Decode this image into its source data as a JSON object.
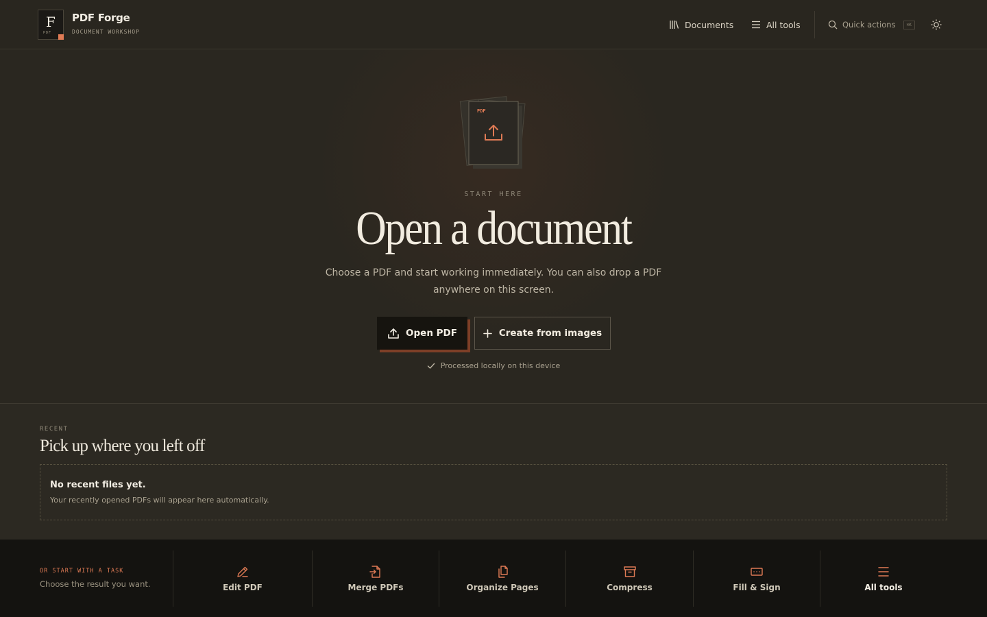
{
  "header": {
    "brand_letter": "F",
    "brand_badge": "PDF",
    "brand_name": "PDF Forge",
    "brand_tagline": "DOCUMENT WORKSHOP",
    "nav": {
      "documents": "Documents",
      "all_tools": "All tools",
      "quick_actions": "Quick actions",
      "quick_actions_shortcut": "⌘K"
    }
  },
  "hero": {
    "doc_badge": "PDF",
    "eyebrow": "START HERE",
    "title": "Open a document",
    "description": "Choose a PDF and start working immediately. You can also drop a PDF anywhere on this screen.",
    "open_button": "Open PDF",
    "create_button": "Create from images",
    "local_note": "Processed locally on this device"
  },
  "recent": {
    "eyebrow": "RECENT",
    "title": "Pick up where you left off",
    "empty_title": "No recent files yet.",
    "empty_description": "Your recently opened PDFs will appear here automatically."
  },
  "tasks": {
    "eyebrow": "OR START WITH A TASK",
    "subtitle": "Choose the result you want.",
    "items": [
      {
        "label": "Edit PDF",
        "icon": "pencil-icon"
      },
      {
        "label": "Merge PDFs",
        "icon": "file-merge-icon"
      },
      {
        "label": "Organize Pages",
        "icon": "pages-stack-icon"
      },
      {
        "label": "Compress",
        "icon": "archive-box-icon"
      },
      {
        "label": "Fill & Sign",
        "icon": "form-field-icon"
      },
      {
        "label": "All tools",
        "icon": "menu-lines-icon"
      }
    ]
  },
  "colors": {
    "accent": "#e07b55",
    "background": "#2a2720",
    "task_bar": "#141310"
  }
}
